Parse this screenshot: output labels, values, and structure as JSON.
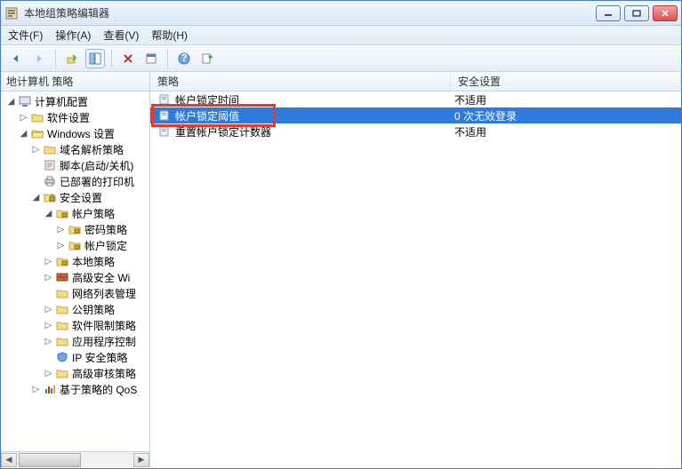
{
  "window": {
    "title": "本地组策略编辑器"
  },
  "menu": {
    "file": "文件(F)",
    "action": "操作(A)",
    "view": "查看(V)",
    "help": "帮助(H)"
  },
  "tree": {
    "header": "地计算机 策略",
    "nodes": {
      "n1": "计算机配置",
      "n2": "软件设置",
      "n3": "Windows 设置",
      "n4": "域名解析策略",
      "n5": "脚本(启动/关机)",
      "n6": "已部署的打印机",
      "n7": "安全设置",
      "n8": "帐户策略",
      "n9": "密码策略",
      "n10": "帐户锁定",
      "n11": "本地策略",
      "n12": "高级安全 Wi",
      "n13": "网络列表管理",
      "n14": "公钥策略",
      "n15": "软件限制策略",
      "n16": "应用程序控制",
      "n17": "IP 安全策略",
      "n18": "高级审核策略",
      "n19": "基于策略的 QoS"
    }
  },
  "list": {
    "col1": "策略",
    "col2": "安全设置",
    "rows": [
      {
        "name": "帐户锁定时间",
        "value": "不适用"
      },
      {
        "name": "帐户锁定阈值",
        "value": "0 次无效登录"
      },
      {
        "name": "重置帐户锁定计数器",
        "value": "不适用"
      }
    ]
  }
}
